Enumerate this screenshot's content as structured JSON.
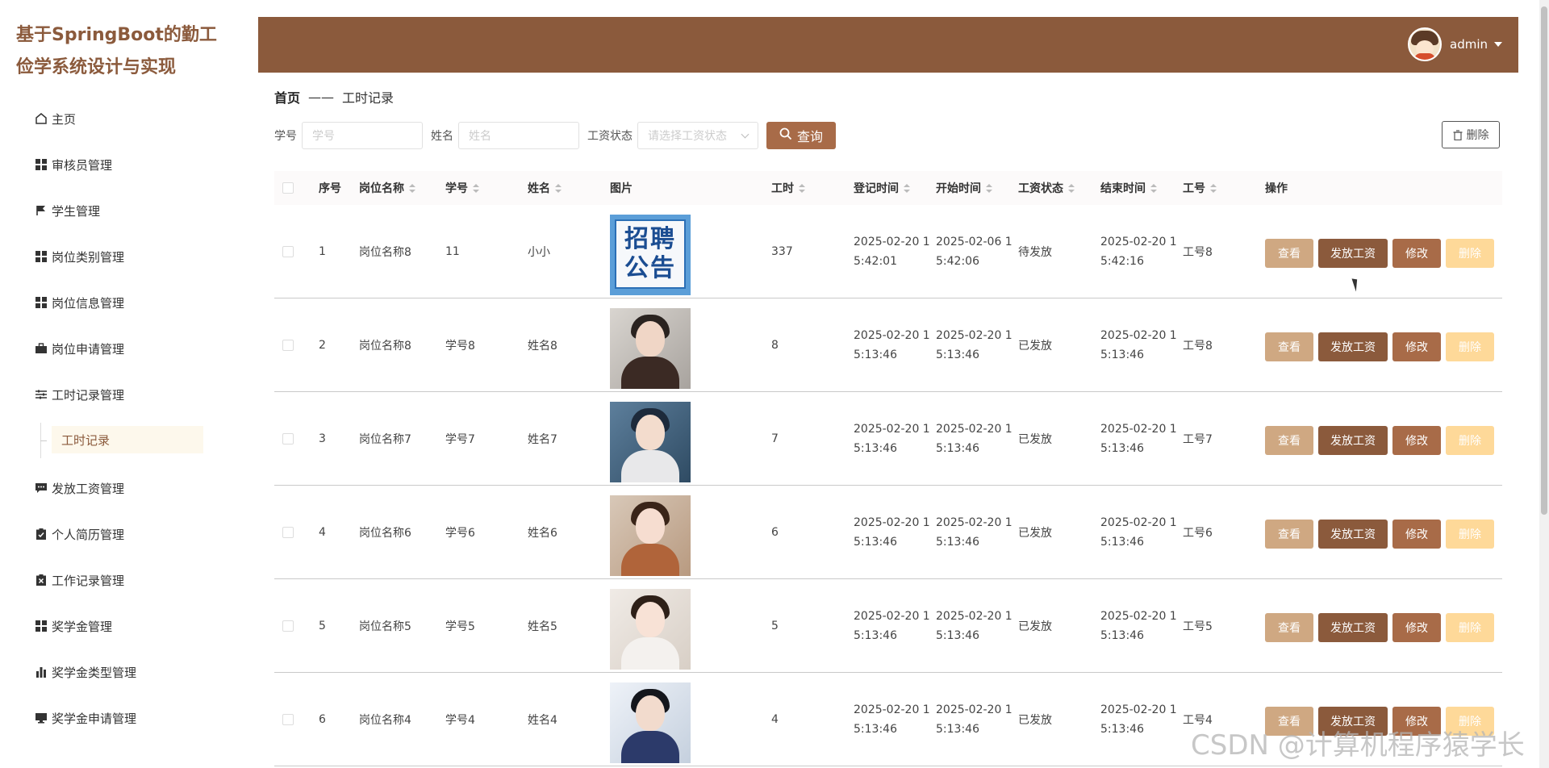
{
  "app": {
    "title": "基于SpringBoot的勤工俭学系统设计与实现"
  },
  "sidebar": {
    "items": [
      {
        "label": "主页",
        "icon": "home-icon"
      },
      {
        "label": "审核员管理",
        "icon": "grid-icon"
      },
      {
        "label": "学生管理",
        "icon": "flag-icon"
      },
      {
        "label": "岗位类别管理",
        "icon": "grid-icon"
      },
      {
        "label": "岗位信息管理",
        "icon": "grid-icon"
      },
      {
        "label": "岗位申请管理",
        "icon": "briefcase-icon"
      },
      {
        "label": "工时记录管理",
        "icon": "sliders-icon"
      },
      {
        "label": "发放工资管理",
        "icon": "message-icon"
      },
      {
        "label": "个人简历管理",
        "icon": "clipboard-check-icon"
      },
      {
        "label": "工作记录管理",
        "icon": "clipboard-x-icon"
      },
      {
        "label": "奖学金管理",
        "icon": "grid-icon"
      },
      {
        "label": "奖学金类型管理",
        "icon": "bar-chart-icon"
      },
      {
        "label": "奖学金申请管理",
        "icon": "monitor-icon"
      }
    ],
    "submenu": {
      "label": "工时记录"
    }
  },
  "header": {
    "username": "admin"
  },
  "breadcrumb": {
    "home": "首页",
    "sep": "——",
    "current": "工时记录"
  },
  "search": {
    "xuehao_label": "学号",
    "xuehao_placeholder": "学号",
    "name_label": "姓名",
    "name_placeholder": "姓名",
    "status_label": "工资状态",
    "status_placeholder": "请选择工资状态",
    "query_label": "查询",
    "delete_label": "删除"
  },
  "table": {
    "headers": [
      "序号",
      "岗位名称",
      "学号",
      "姓名",
      "图片",
      "工时",
      "登记时间",
      "开始时间",
      "工资状态",
      "结束时间",
      "工号",
      "操作"
    ],
    "actions": {
      "view": "查看",
      "pay": "发放工资",
      "edit": "修改",
      "delete": "删除"
    },
    "rows": [
      {
        "no": "1",
        "post": "岗位名称8",
        "xuehao": "11",
        "name": "小小",
        "hours": "337",
        "reg1": "2025-02-20 1",
        "reg2": "5:42:01",
        "start1": "2025-02-06 1",
        "start2": "5:42:06",
        "status": "待发放",
        "end1": "2025-02-20 1",
        "end2": "5:42:16",
        "gonghao": "工号8",
        "poster1": "招聘",
        "poster2": "公告"
      },
      {
        "no": "2",
        "post": "岗位名称8",
        "xuehao": "学号8",
        "name": "姓名8",
        "hours": "8",
        "reg1": "2025-02-20 1",
        "reg2": "5:13:46",
        "start1": "2025-02-20 1",
        "start2": "5:13:46",
        "status": "已发放",
        "end1": "2025-02-20 1",
        "end2": "5:13:46",
        "gonghao": "工号8"
      },
      {
        "no": "3",
        "post": "岗位名称7",
        "xuehao": "学号7",
        "name": "姓名7",
        "hours": "7",
        "reg1": "2025-02-20 1",
        "reg2": "5:13:46",
        "start1": "2025-02-20 1",
        "start2": "5:13:46",
        "status": "已发放",
        "end1": "2025-02-20 1",
        "end2": "5:13:46",
        "gonghao": "工号7"
      },
      {
        "no": "4",
        "post": "岗位名称6",
        "xuehao": "学号6",
        "name": "姓名6",
        "hours": "6",
        "reg1": "2025-02-20 1",
        "reg2": "5:13:46",
        "start1": "2025-02-20 1",
        "start2": "5:13:46",
        "status": "已发放",
        "end1": "2025-02-20 1",
        "end2": "5:13:46",
        "gonghao": "工号6"
      },
      {
        "no": "5",
        "post": "岗位名称5",
        "xuehao": "学号5",
        "name": "姓名5",
        "hours": "5",
        "reg1": "2025-02-20 1",
        "reg2": "5:13:46",
        "start1": "2025-02-20 1",
        "start2": "5:13:46",
        "status": "已发放",
        "end1": "2025-02-20 1",
        "end2": "5:13:46",
        "gonghao": "工号5"
      },
      {
        "no": "6",
        "post": "岗位名称4",
        "xuehao": "学号4",
        "name": "姓名4",
        "hours": "4",
        "reg1": "2025-02-20 1",
        "reg2": "5:13:46",
        "start1": "2025-02-20 1",
        "start2": "5:13:46",
        "status": "已发放",
        "end1": "2025-02-20 1",
        "end2": "5:13:46",
        "gonghao": "工号4"
      }
    ]
  },
  "watermark": "CSDN @计算机程序猿学长",
  "colors": {
    "primary": "#8b5a3c",
    "view": "#cfa882",
    "edit": "#a86b48",
    "delete": "#fed999"
  }
}
